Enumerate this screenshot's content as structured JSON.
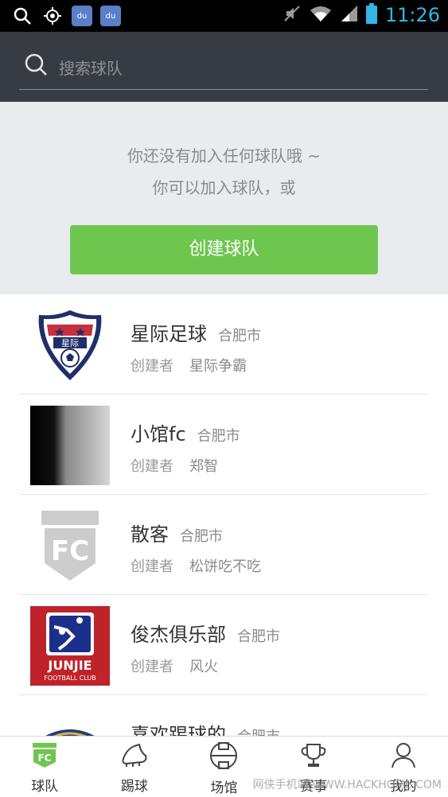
{
  "status_bar": {
    "time": "11:26"
  },
  "search": {
    "placeholder": "搜索球队"
  },
  "empty_state": {
    "line1": "你还没有加入任何球队哦 ~",
    "line2": "你可以加入球队，或",
    "create_button": "创建球队"
  },
  "teams": [
    {
      "name": "星际足球",
      "city": "合肥市",
      "creator_label": "创建者",
      "creator": "星际争霸"
    },
    {
      "name": "小馆fc",
      "city": "合肥市",
      "creator_label": "创建者",
      "creator": "郑智"
    },
    {
      "name": "散客",
      "city": "合肥市",
      "creator_label": "创建者",
      "creator": "松饼吃不吃"
    },
    {
      "name": "俊杰俱乐部",
      "city": "合肥市",
      "creator_label": "创建者",
      "creator": "风火"
    },
    {
      "name": "喜欢踢球的",
      "city": "合肥市"
    }
  ],
  "nav": {
    "items": [
      {
        "label": "球队",
        "icon": "team-fc-icon"
      },
      {
        "label": "踢球",
        "icon": "football-boot-icon"
      },
      {
        "label": "场馆",
        "icon": "field-icon"
      },
      {
        "label": "赛事",
        "icon": "trophy-icon"
      },
      {
        "label": "我的",
        "icon": "profile-icon"
      }
    ]
  },
  "logo_texts": {
    "junjie": "JUNJIE",
    "junjie_sub": "FOOTBALL CLUB",
    "fc": "FC",
    "xingji": "星际"
  },
  "watermark": "网侠手机站 WWW.HACKHOME.COM",
  "colors": {
    "accent_green": "#6fc64f",
    "header_dark": "#373c42",
    "clock_blue": "#33b5e5"
  }
}
